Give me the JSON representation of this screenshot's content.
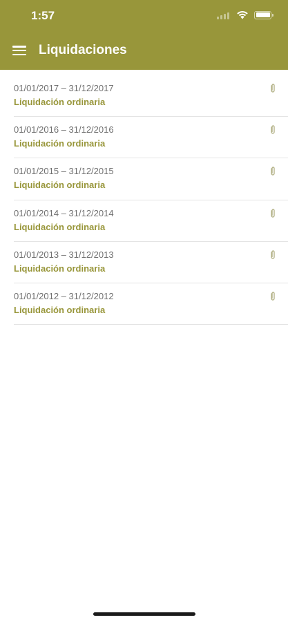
{
  "status_bar": {
    "time": "1:57"
  },
  "header": {
    "title": "Liquidaciones",
    "background_color": "#98963a"
  },
  "list": {
    "items": [
      {
        "period": "01/01/2017 – 31/12/2017",
        "type": "Liquidación ordinaria",
        "icon": "paperclip-icon"
      },
      {
        "period": "01/01/2016 – 31/12/2016",
        "type": "Liquidación ordinaria",
        "icon": "paperclip-icon"
      },
      {
        "period": "01/01/2015 – 31/12/2015",
        "type": "Liquidación ordinaria",
        "icon": "paperclip-icon"
      },
      {
        "period": "01/01/2014 – 31/12/2014",
        "type": "Liquidación ordinaria",
        "icon": "paperclip-icon"
      },
      {
        "period": "01/01/2013 – 31/12/2013",
        "type": "Liquidación ordinaria",
        "icon": "paperclip-icon"
      },
      {
        "period": "01/01/2012 – 31/12/2012",
        "type": "Liquidación ordinaria",
        "icon": "paperclip-icon"
      }
    ]
  },
  "colors": {
    "accent": "#98963a",
    "period_text": "#6f6f6f",
    "divider": "#e4e4e4"
  }
}
